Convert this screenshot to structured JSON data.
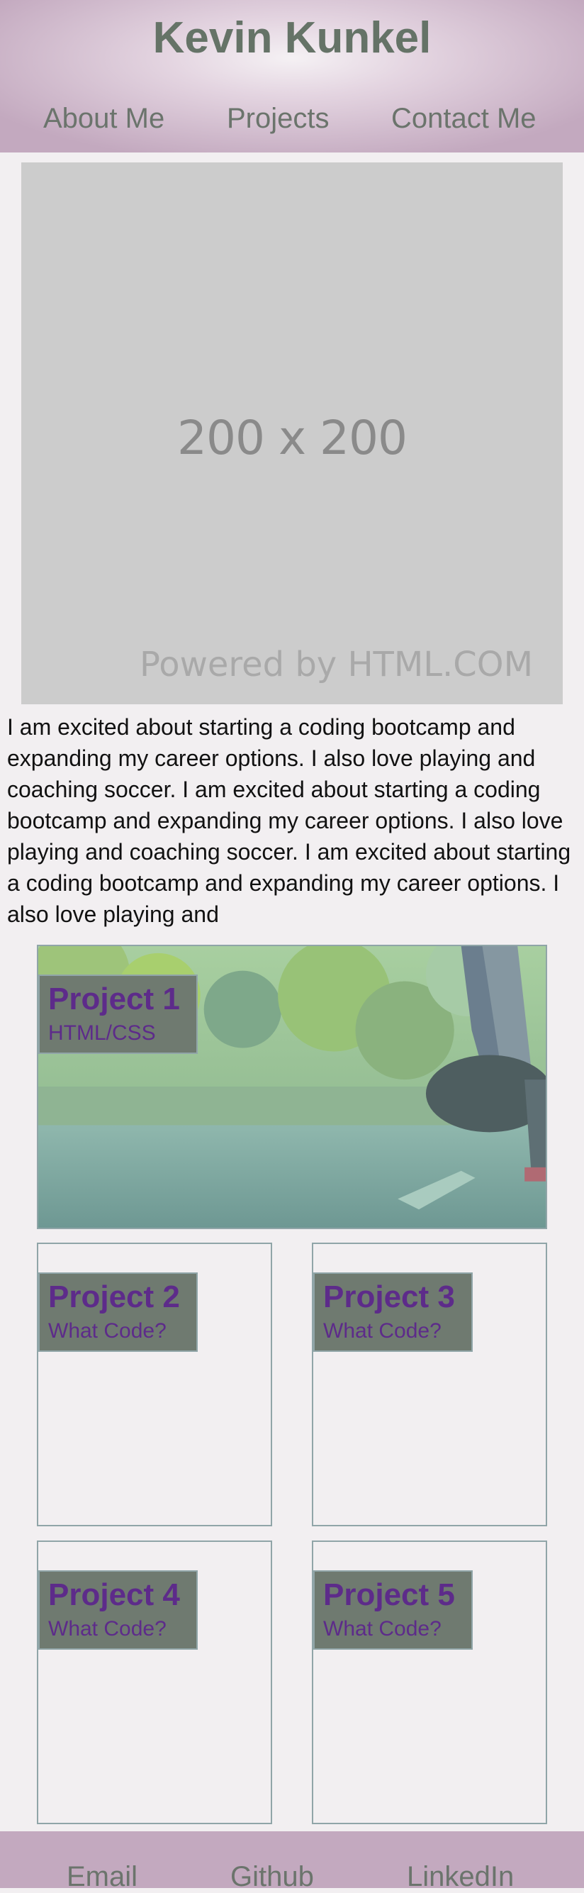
{
  "header": {
    "title": "Kevin Kunkel",
    "nav": [
      {
        "label": "About Me"
      },
      {
        "label": "Projects"
      },
      {
        "label": "Contact Me"
      }
    ]
  },
  "hero_image": {
    "size_text": "200 x 200",
    "powered_text": "Powered by HTML.COM"
  },
  "bio": "I am excited about starting a coding bootcamp and expanding my career options. I also love playing and coaching soccer. I am excited about starting a coding bootcamp and expanding my career options. I also love playing and coaching soccer. I am excited about starting a coding bootcamp and expanding my career options. I also love playing and",
  "projects": [
    {
      "title": "Project 1",
      "subtitle": "HTML/CSS"
    },
    {
      "title": "Project 2",
      "subtitle": "What Code?"
    },
    {
      "title": "Project 3",
      "subtitle": "What Code?"
    },
    {
      "title": "Project 4",
      "subtitle": "What Code?"
    },
    {
      "title": "Project 5",
      "subtitle": "What Code?"
    }
  ],
  "footer": {
    "links": [
      {
        "label": "Email"
      },
      {
        "label": "Github"
      },
      {
        "label": "LinkedIn"
      }
    ]
  },
  "colors": {
    "header_bg": "#c3a9bf",
    "title_text": "#657367",
    "card_label_bg": "#6f7a70",
    "card_label_text": "#5d2b8a",
    "card_border": "#90a5a8",
    "page_bg": "#f2eff1"
  }
}
